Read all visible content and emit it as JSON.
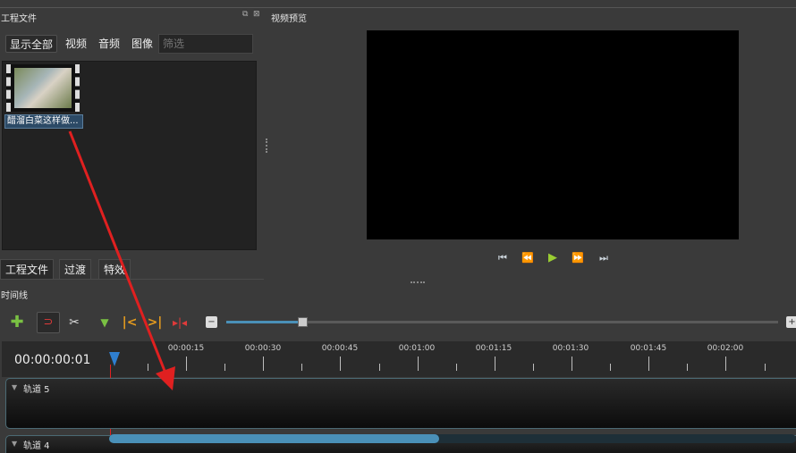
{
  "project_files": {
    "title": "工程文件",
    "filters": [
      "显示全部",
      "视频",
      "音频",
      "图像"
    ],
    "filter_placeholder": "筛选",
    "file": {
      "name": "醋溜白菜这样做..."
    }
  },
  "preview": {
    "title": "视频预览"
  },
  "bottom_tabs": [
    "工程文件",
    "过渡",
    "特效"
  ],
  "timeline": {
    "title": "时间线",
    "timecode": "00:00:00:01",
    "ruler_labels": [
      "00:00:15",
      "00:00:30",
      "00:00:45",
      "00:01:00",
      "00:01:15",
      "00:01:30",
      "00:01:45",
      "00:02:00"
    ],
    "tracks": [
      {
        "label": "轨道 5"
      },
      {
        "label": "轨道 4"
      }
    ]
  },
  "colors": {
    "accent_play": "#9acd32",
    "accent_orange": "#e39a1e",
    "annotation_arrow": "#e02020",
    "scroll_thumb": "#4a90b8"
  }
}
